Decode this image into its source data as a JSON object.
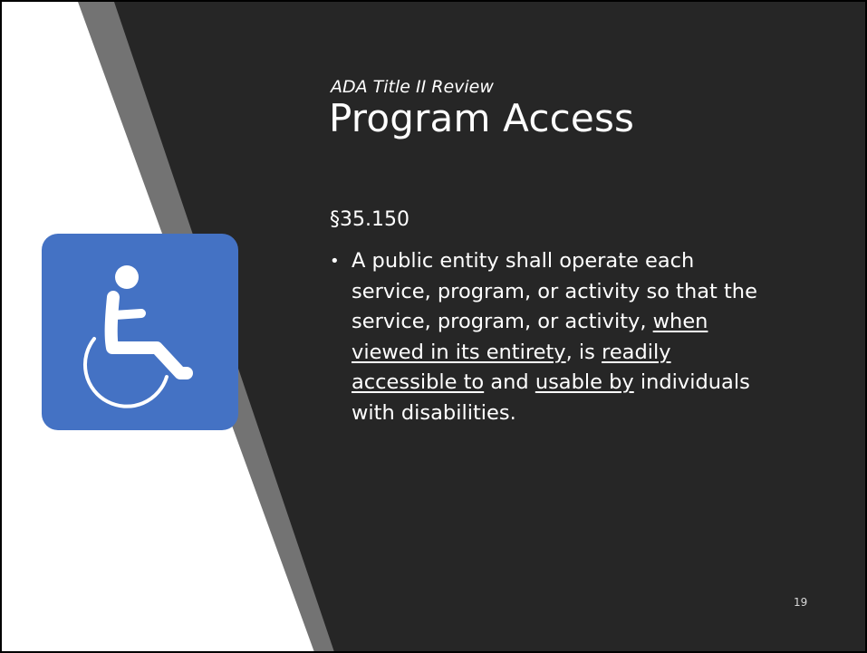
{
  "slide": {
    "subtitle": "ADA Title II Review",
    "title": "Program Access",
    "section_heading": "§35.150",
    "bullet_marker": "•",
    "bullet_lines": [
      [
        {
          "text": "A public entity shall operate each"
        }
      ],
      [
        {
          "text": "service, program, or activity so that the"
        }
      ],
      [
        {
          "text": "service, program, or activity, "
        },
        {
          "text": "when",
          "underline": true
        }
      ],
      [
        {
          "text": "viewed in its entirety",
          "underline": true
        },
        {
          "text": ", is "
        },
        {
          "text": "readily",
          "underline": true
        }
      ],
      [
        {
          "text": "accessible to",
          "underline": true
        },
        {
          "text": " and "
        },
        {
          "text": "usable by",
          "underline": true
        },
        {
          "text": " individuals"
        }
      ],
      [
        {
          "text": "with disabilities."
        }
      ]
    ],
    "page_number": "19"
  },
  "icon": {
    "name": "wheelchair-icon",
    "tile_color": "#4472c4"
  },
  "colors": {
    "background_dark": "#262626",
    "stripe_gray": "#737373",
    "left_panel": "#ffffff",
    "text": "#ffffff"
  }
}
